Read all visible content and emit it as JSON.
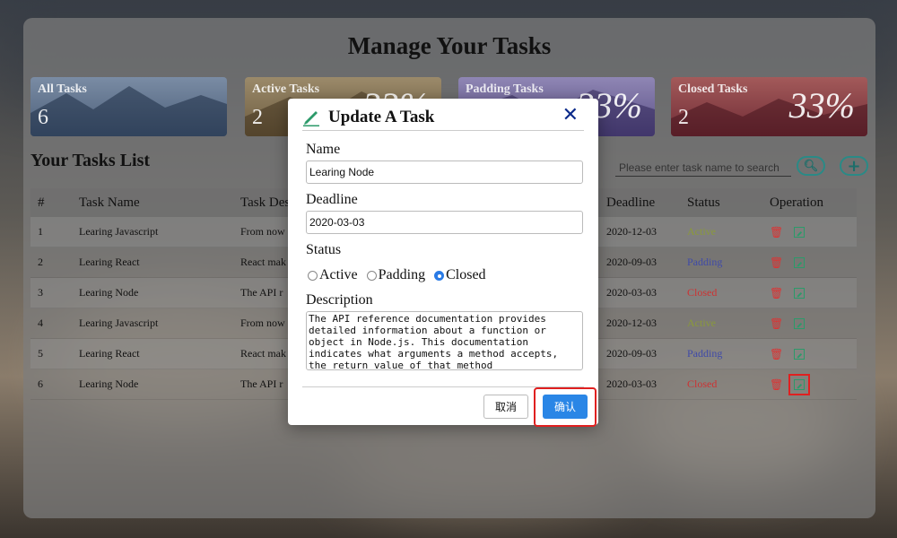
{
  "page_title": "Manage Your Tasks",
  "stats": [
    {
      "label": "All Tasks",
      "count": "6",
      "percent": ""
    },
    {
      "label": "Active Tasks",
      "count": "2",
      "percent": "33%"
    },
    {
      "label": "Padding Tasks",
      "count": "2",
      "percent": "33%"
    },
    {
      "label": "Closed Tasks",
      "count": "2",
      "percent": "33%"
    }
  ],
  "list_title": "Your Tasks List",
  "search": {
    "placeholder": "Please enter task name to search"
  },
  "table": {
    "headers": [
      "#",
      "Task Name",
      "Task Des",
      "Deadline",
      "Status",
      "Operation"
    ],
    "rows": [
      {
        "num": "1",
        "name": "Learing Javascript",
        "desc": "From now",
        "deadline": "2020-12-03",
        "status": "Active"
      },
      {
        "num": "2",
        "name": "Learing React",
        "desc": "React mak",
        "deadline": "2020-09-03",
        "status": "Padding"
      },
      {
        "num": "3",
        "name": "Learing Node",
        "desc": "The API r",
        "deadline": "2020-03-03",
        "status": "Closed"
      },
      {
        "num": "4",
        "name": "Learing Javascript",
        "desc": "From now",
        "deadline": "2020-12-03",
        "status": "Active"
      },
      {
        "num": "5",
        "name": "Learing React",
        "desc": "React mak",
        "deadline": "2020-09-03",
        "status": "Padding"
      },
      {
        "num": "6",
        "name": "Learing Node",
        "desc": "The API r",
        "deadline": "2020-03-03",
        "status": "Closed"
      }
    ]
  },
  "modal": {
    "title": "Update A Task",
    "name_label": "Name",
    "name_value": "Learing Node",
    "deadline_label": "Deadline",
    "deadline_value": "2020-03-03",
    "status_label": "Status",
    "status_options": [
      "Active",
      "Padding",
      "Closed"
    ],
    "status_selected": "Closed",
    "description_label": "Description",
    "description_value": "The API reference documentation provides detailed information about a function or object in Node.js. This documentation indicates what arguments a method accepts, the return value of that method",
    "cancel_label": "取消",
    "ok_label": "确认"
  },
  "colors": {
    "primary": "#2a86e6",
    "highlight": "#e02020",
    "active": "#8a9a3a",
    "padding": "#3f4aa8",
    "closed": "#cc3333"
  }
}
